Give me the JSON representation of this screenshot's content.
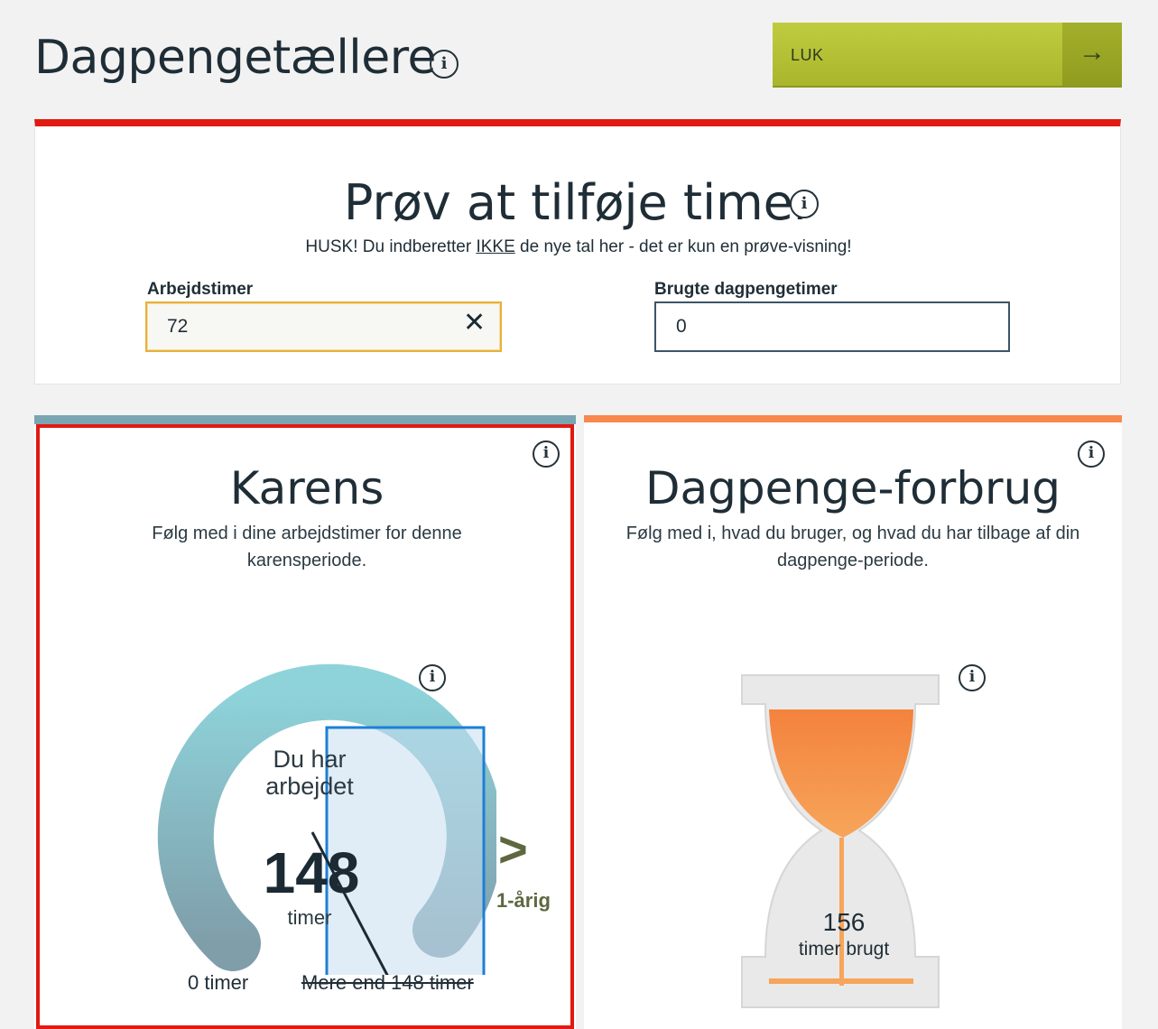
{
  "header": {
    "title": "Dagpengetællere",
    "close_label": "LUK",
    "close_arrow": "→"
  },
  "try_card": {
    "title": "Prøv at tilføje timer",
    "note_prefix": "HUSK! Du indberetter ",
    "note_emphasis": "IKKE",
    "note_suffix": " de nye tal her - det er kun en prøve-visning!",
    "arbejdstimer_label": "Arbejdstimer",
    "arbejdstimer_value": "72",
    "brugte_label": "Brugte dagpengetimer",
    "brugte_value": "0"
  },
  "karens": {
    "title": "Karens",
    "description": "Følg med i dine arbejdstimer for denne karensperiode.",
    "gauge_text": "Du har arbejdet",
    "value": "148",
    "unit": "timer",
    "min_label": "0 timer",
    "max_label": "Mere end 148 timer",
    "chevron": ">",
    "type_label": "1-årig",
    "progress_fraction": 1.0
  },
  "forbrug": {
    "title": "Dagpenge-forbrug",
    "description": "Følg med i, hvad du bruger, og hvad du har tilbage af din dagpenge-periode.",
    "value": "156",
    "unit": "timer brugt"
  },
  "icons": {
    "info": "i",
    "clear": "✕"
  },
  "colors": {
    "accent_red": "#e11a12",
    "button_green": "#b5c134",
    "karens_teal": "#7aa5b3",
    "forbrug_orange": "#f7894f"
  }
}
